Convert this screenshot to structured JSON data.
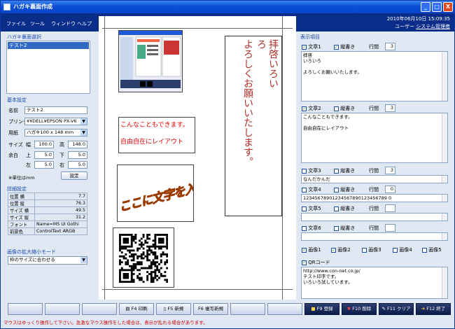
{
  "window": {
    "title": "ハガキ裏面作成",
    "min": "_",
    "max": "□",
    "close": "X"
  },
  "menu": [
    "ファイル",
    "ツール",
    "ウィンドウ",
    "ヘルプ"
  ],
  "header": {
    "datetime": "2010年06月10日 15:09:35",
    "user_label": "ユーザー",
    "user_name": "システム管理者"
  },
  "left": {
    "select_title": "ハガキ裏面選択",
    "list_item": "テスト2",
    "basic_title": "基本設定",
    "name_label": "名前",
    "name_value": "テスト2",
    "printer_label": "プリンタ",
    "printer_value": "¥¥DELL¥EPSON PX-V6",
    "paper_label": "用紙",
    "paper_value": "ハガキ100 x 148 mm",
    "size_label": "サイズ",
    "width_label": "幅",
    "width_value": "100.0",
    "height_label": "高",
    "height_value": "148.0",
    "margin_label": "余白",
    "top_label": "上",
    "top_value": "5.0",
    "bottom_label": "下",
    "bottom_value": "5.0",
    "left_label": "左",
    "left_value": "5.0",
    "right_label": "右",
    "right_value": "5.0",
    "unit_note": "※単位はmm",
    "settings_button": "設定",
    "detail_title": "詳細設定",
    "detail_rows": [
      [
        "位置 横",
        "7.7"
      ],
      [
        "位置 縦",
        "76.3"
      ],
      [
        "サイズ 横",
        "49.5"
      ],
      [
        "サイズ 縦",
        "31.2"
      ],
      [
        "フォント",
        "Name=MS UI Gothi"
      ],
      [
        "前景色",
        "ControlText ARGB"
      ]
    ],
    "zoom_title": "画像の拡大縮小モード",
    "zoom_value": "枠のサイズに合わせる"
  },
  "canvas": {
    "vertical_right": "拝啓いろいろ",
    "vertical_main": "よろしくお願いいたします。",
    "red_line1": "こんなこともできます。",
    "red_line2": "自由自在にレイアウト",
    "wordart": "ここに文字を入力"
  },
  "right": {
    "title": "表示項目",
    "bun1": "文章1",
    "tate": "縦書き",
    "gyokan": "行間",
    "bun1_gyokan": "3",
    "bun1_text": "拝啓\nいろいろ\n\nよろしくお願いいたします。",
    "bun2": "文章2",
    "bun2_gyokan": "3",
    "bun2_text": "こんなこともできます。\n\n自由自在にレイアウト",
    "bun3": "文章3",
    "bun3_gyokan": "3",
    "bun3_text": "なんだかんだ",
    "bun4": "文章4",
    "bun4_gyokan": "0",
    "bun4_text": "12345678901234567890123456789 0",
    "bun5": "文章5",
    "bun6": "文章6",
    "images": [
      "画像1",
      "画像2",
      "画像3",
      "画像4",
      "画像5"
    ],
    "qr_label": "QRコード",
    "qr_text": "http://www.con-net.co.jp/\nテスト印字です。\nいろいろ試しています。"
  },
  "footer": {
    "f4": "F4 印刷",
    "f5": "F5 新規",
    "f6": "F6 複写新規",
    "f9": "F9 登録",
    "f10": "F10 削除",
    "f11": "F11 クリア",
    "f12": "F12 終了"
  },
  "status": "マウスはゆっくり操作して下さい。急激なマウス操作をした場合は、表示が乱れる場合があります。",
  "colors": {
    "title_bar": "#0a4fd6",
    "menu_bar": "#0a2d8a",
    "red_text": "#e00000",
    "vertical_text": "#b0302a"
  }
}
